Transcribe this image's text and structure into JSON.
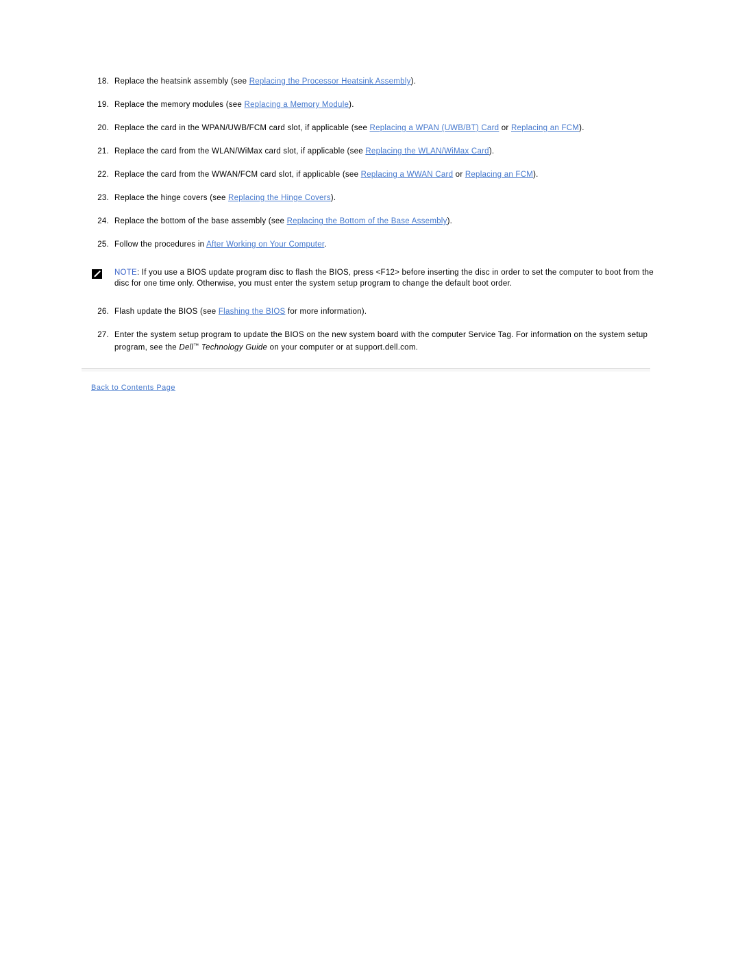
{
  "document": {
    "steps": [
      {
        "number": "18.",
        "parts": [
          {
            "type": "text",
            "text": "Replace the heatsink assembly (see "
          },
          {
            "type": "link",
            "text": "Replacing the Processor Heatsink Assembly"
          },
          {
            "type": "text",
            "text": ")."
          }
        ]
      },
      {
        "number": "19.",
        "parts": [
          {
            "type": "text",
            "text": "Replace the memory modules (see "
          },
          {
            "type": "link",
            "text": "Replacing a Memory Module"
          },
          {
            "type": "text",
            "text": ")."
          }
        ]
      },
      {
        "number": "20.",
        "parts": [
          {
            "type": "text",
            "text": "Replace the card in the WPAN/UWB/FCM card slot, if applicable (see "
          },
          {
            "type": "link",
            "text": "Replacing a WPAN (UWB/BT) Card"
          },
          {
            "type": "text",
            "text": " or "
          },
          {
            "type": "link",
            "text": "Replacing an FCM"
          },
          {
            "type": "text",
            "text": ")."
          }
        ]
      },
      {
        "number": "21.",
        "parts": [
          {
            "type": "text",
            "text": "Replace the card from the WLAN/WiMax card slot, if applicable (see "
          },
          {
            "type": "link",
            "text": "Replacing the WLAN/WiMax Card"
          },
          {
            "type": "text",
            "text": ")."
          }
        ]
      },
      {
        "number": "22.",
        "parts": [
          {
            "type": "text",
            "text": "Replace the card from the WWAN/FCM card slot, if applicable (see "
          },
          {
            "type": "link",
            "text": "Replacing a WWAN Card"
          },
          {
            "type": "text",
            "text": " or "
          },
          {
            "type": "link",
            "text": "Replacing an FCM"
          },
          {
            "type": "text",
            "text": ")."
          }
        ]
      },
      {
        "number": "23.",
        "parts": [
          {
            "type": "text",
            "text": "Replace the hinge covers (see "
          },
          {
            "type": "link",
            "text": "Replacing the Hinge Covers"
          },
          {
            "type": "text",
            "text": ")."
          }
        ]
      },
      {
        "number": "24.",
        "parts": [
          {
            "type": "text",
            "text": "Replace the bottom of the base assembly (see "
          },
          {
            "type": "link",
            "text": "Replacing the Bottom of the Base Assembly"
          },
          {
            "type": "text",
            "text": ")."
          }
        ]
      },
      {
        "number": "25.",
        "parts": [
          {
            "type": "text",
            "text": "Follow the procedures in "
          },
          {
            "type": "link",
            "text": "After Working on Your Computer"
          },
          {
            "type": "text",
            "text": "."
          }
        ]
      }
    ],
    "note": {
      "icon": "note-pencil-icon",
      "label": "NOTE",
      "separator": ": ",
      "text": "If you use a BIOS update program disc to flash the BIOS, press <F12> before inserting the disc in order to set the computer to boot from the disc for one time only. Otherwise, you must enter the system setup program to change the default boot order."
    },
    "steps_after_note": [
      {
        "number": "26.",
        "parts": [
          {
            "type": "text",
            "text": "Flash update the BIOS (see "
          },
          {
            "type": "link",
            "text": "Flashing the BIOS"
          },
          {
            "type": "text",
            "text": " for more information)."
          }
        ]
      },
      {
        "number": "27.",
        "parts": [
          {
            "type": "text",
            "text": "Enter the system setup program to update the BIOS on the new system board with the computer Service Tag. For information on the system setup program, see the "
          },
          {
            "type": "italic",
            "text": "Dell"
          },
          {
            "type": "trademark",
            "text": "™"
          },
          {
            "type": "italic",
            "text": " Technology Guide"
          },
          {
            "type": "text",
            "text": " on your computer or at support.dell.com."
          }
        ]
      }
    ],
    "footer": {
      "back_link": "Back to Contents Page"
    },
    "colors": {
      "link": "#4477cc",
      "note_label": "#3a63c8",
      "body_text": "#000000",
      "rule": "#b8b8b8",
      "background": "#ffffff"
    }
  }
}
